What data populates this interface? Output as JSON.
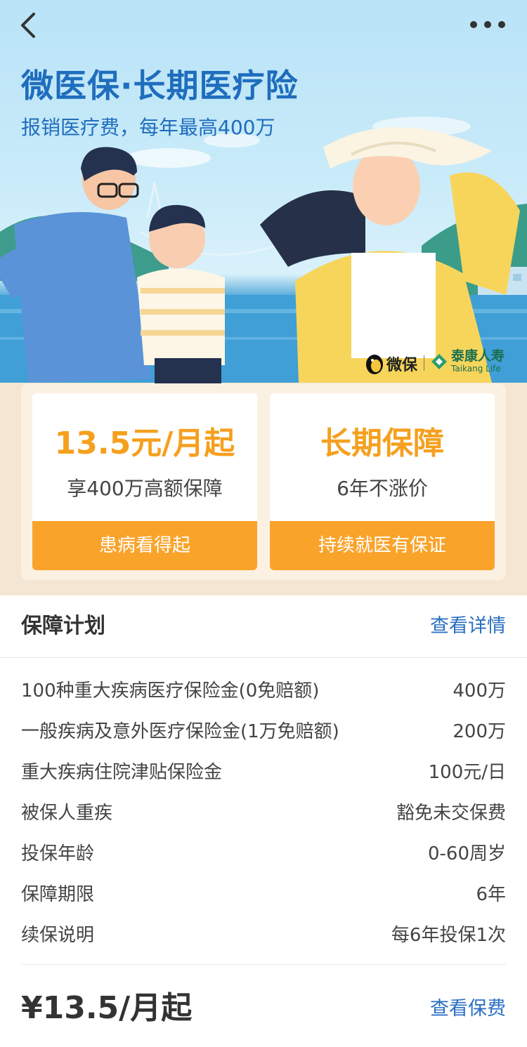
{
  "hero": {
    "title": "微医保·长期医疗险",
    "subtitle": "报销医疗费，每年最高400万",
    "brand_weibao": "微保",
    "brand_taikang_cn": "泰康人寿",
    "brand_taikang_en": "Taikang Life",
    "icons": [
      "back-arrow-icon",
      "more-dots-icon"
    ]
  },
  "features": [
    {
      "headline": "13.5元/月起",
      "desc": "享400万高额保障",
      "button": "患病看得起"
    },
    {
      "headline": "长期保障",
      "desc": "6年不涨价",
      "button": "持续就医有保证"
    }
  ],
  "plan": {
    "title": "保障计划",
    "detail_link": "查看详情",
    "rows": [
      {
        "name": "100种重大疾病医疗保险金(0免赔额)",
        "value": "400万"
      },
      {
        "name": "一般疾病及意外医疗保险金(1万免赔额)",
        "value": "200万"
      },
      {
        "name": "重大疾病住院津贴保险金",
        "value": "100元/日"
      },
      {
        "name": "被保人重疾",
        "value": "豁免未交保费"
      },
      {
        "name": "投保年龄",
        "value": "0-60周岁"
      },
      {
        "name": "保障期限",
        "value": "6年"
      },
      {
        "name": "续保说明",
        "value": "每6年投保1次"
      }
    ]
  },
  "footer": {
    "price": "¥13.5/月起",
    "price_link": "查看保费"
  },
  "colors": {
    "accent_orange": "#faa32a",
    "headline_orange": "#f5a01f",
    "title_blue": "#1f6dbd",
    "link_blue": "#2a6fc2"
  }
}
